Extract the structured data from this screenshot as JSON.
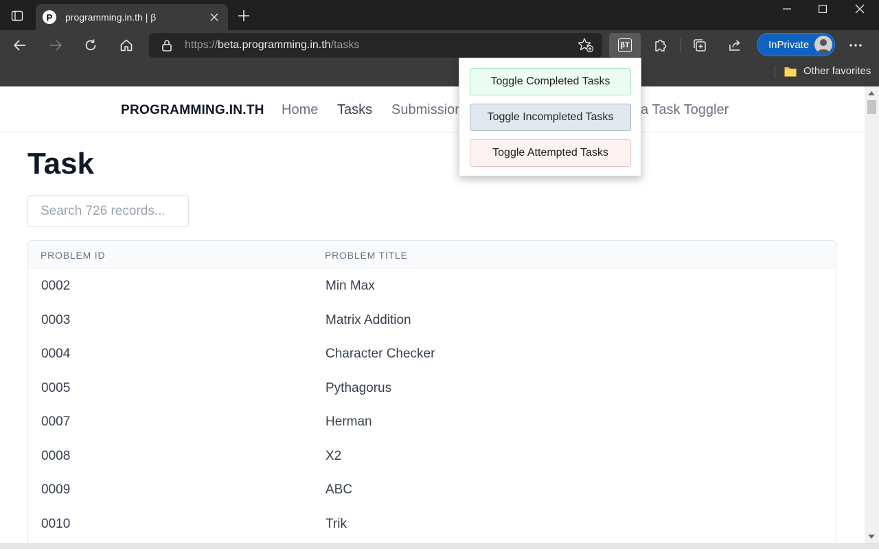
{
  "browser": {
    "tab_title": "programming.in.th | β",
    "favicon_letter": "P",
    "url_scheme": "https://",
    "url_host": "beta.programming.in.th",
    "url_path": "/tasks",
    "inprivate_label": "InPrivate",
    "other_favorites": "Other favorites",
    "extension_badge": "βT"
  },
  "site": {
    "brand": "PROGRAMMING.IN.TH",
    "nav": [
      "Home",
      "Tasks",
      "Submissions",
      "Beta Task Toggler"
    ]
  },
  "page": {
    "title": "Task",
    "search_placeholder": "Search 726 records..."
  },
  "table": {
    "columns": [
      "PROBLEM ID",
      "PROBLEM TITLE"
    ],
    "rows": [
      {
        "id": "0002",
        "title": "Min Max"
      },
      {
        "id": "0003",
        "title": "Matrix Addition"
      },
      {
        "id": "0004",
        "title": "Character Checker"
      },
      {
        "id": "0005",
        "title": "Pythagorus"
      },
      {
        "id": "0007",
        "title": "Herman"
      },
      {
        "id": "0008",
        "title": "X2"
      },
      {
        "id": "0009",
        "title": "ABC"
      },
      {
        "id": "0010",
        "title": "Trik"
      }
    ]
  },
  "popup": {
    "buttons": [
      "Toggle Completed Tasks",
      "Toggle Incompleted Tasks",
      "Toggle Attempted Tasks"
    ]
  },
  "colors": {
    "chrome_dark": "#202020",
    "toolbar": "#3b3b3b",
    "inprivate": "#0f62bd",
    "completed": "#ecfdf3",
    "incompleted": "#e2e8f0",
    "attempted": "#fef2f2"
  }
}
